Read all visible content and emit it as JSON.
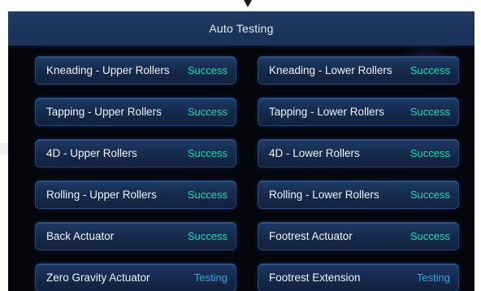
{
  "header": {
    "title": "Auto Testing"
  },
  "colors": {
    "success": "#23d7b9",
    "testing": "#2fa8e8",
    "header_bg": "#1f3a63",
    "screen_bg": "#04060c"
  },
  "tests": [
    {
      "label": "Kneading - Upper Rollers",
      "status": "Success",
      "state": "success"
    },
    {
      "label": "Kneading - Lower Rollers",
      "status": "Success",
      "state": "success"
    },
    {
      "label": "Tapping - Upper Rollers",
      "status": "Success",
      "state": "success"
    },
    {
      "label": "Tapping - Lower Rollers",
      "status": "Success",
      "state": "success"
    },
    {
      "label": "4D - Upper Rollers",
      "status": "Success",
      "state": "success"
    },
    {
      "label": "4D - Lower Rollers",
      "status": "Success",
      "state": "success"
    },
    {
      "label": "Rolling - Upper Rollers",
      "status": "Success",
      "state": "success"
    },
    {
      "label": "Rolling - Lower Rollers",
      "status": "Success",
      "state": "success"
    },
    {
      "label": "Back Actuator",
      "status": "Success",
      "state": "success"
    },
    {
      "label": "Footrest Actuator",
      "status": "Success",
      "state": "success"
    },
    {
      "label": "Zero Gravity Actuator",
      "status": "Testing",
      "state": "testing"
    },
    {
      "label": "Footrest Extension",
      "status": "Testing",
      "state": "testing"
    }
  ]
}
